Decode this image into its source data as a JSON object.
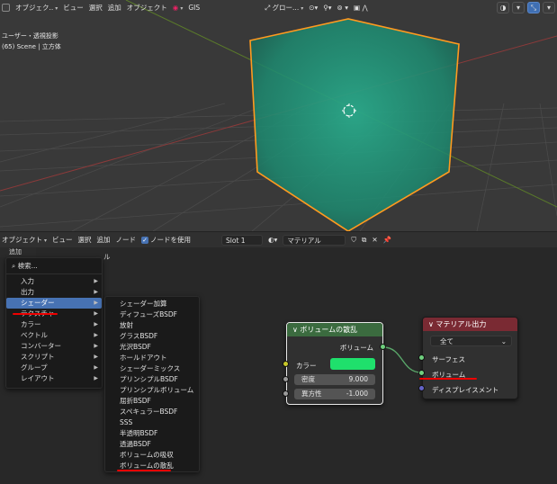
{
  "viewport": {
    "header": {
      "mode": "オブジェク..",
      "view": "ビュー",
      "select": "選択",
      "add": "追加",
      "object": "オブジェクト",
      "gis": "GIS",
      "orientation": "グロー..."
    },
    "info": {
      "line1": "ユーザー・透視投影",
      "line2": "(65) Scene | 立方体"
    }
  },
  "node_editor": {
    "header": {
      "mode": "オブジェクト",
      "view": "ビュー",
      "select": "選択",
      "add": "追加",
      "node": "ノード",
      "use_nodes": "ノードを使用",
      "slot": "Slot 1",
      "material": "マテリアル"
    },
    "add_label": "追加",
    "behind_label": "ル"
  },
  "add_menu": {
    "search": "検索...",
    "items": [
      {
        "label": "入力",
        "submenu": true
      },
      {
        "label": "出力",
        "submenu": true
      },
      {
        "label": "シェーダー",
        "submenu": true,
        "selected": true
      },
      {
        "label": "テクスチャ",
        "submenu": true
      },
      {
        "label": "カラー",
        "submenu": true
      },
      {
        "label": "ベクトル",
        "submenu": true
      },
      {
        "label": "コンバーター",
        "submenu": true
      },
      {
        "label": "スクリプト",
        "submenu": true
      },
      {
        "label": "グループ",
        "submenu": true
      },
      {
        "label": "レイアウト",
        "submenu": true
      }
    ]
  },
  "shader_menu": {
    "items": [
      "シェーダー加算",
      "ディフューズBSDF",
      "放射",
      "グラスBSDF",
      "光沢BSDF",
      "ホールドアウト",
      "シェーダーミックス",
      "プリンシプルBSDF",
      "プリンシプルボリューム",
      "屈折BSDF",
      "スペキュラーBSDF",
      "SSS",
      "半透明BSDF",
      "透過BSDF",
      "ボリュームの吸収",
      "ボリュームの散乱"
    ]
  },
  "volume_scatter_node": {
    "title": "ボリュームの散乱",
    "output": "ボリューム",
    "color_label": "カラー",
    "color_value": "#1fe06c",
    "density_label": "密度",
    "density_value": "9.000",
    "anisotropy_label": "異方性",
    "anisotropy_value": "-1.000"
  },
  "material_output_node": {
    "title": "マテリアル出力",
    "target": "全て",
    "surface": "サーフェス",
    "volume": "ボリューム",
    "displacement": "ディスプレイスメント"
  },
  "colors": {
    "accent_blue": "#4772b3",
    "annotation_red": "#ee0000",
    "shader_header": "#3b6b3f",
    "output_header": "#7a2a33",
    "cube_outline": "#ff9a1f",
    "volume_fill": "#1a7d64"
  }
}
